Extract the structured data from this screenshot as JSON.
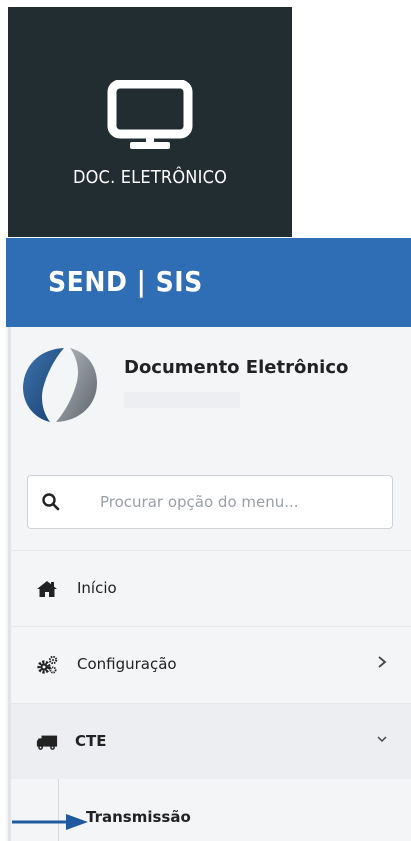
{
  "tile": {
    "label": "DOC. ELETRÔNICO",
    "icon": "monitor-icon"
  },
  "header": {
    "brand": "SEND | SIS",
    "color": "#2f6db5"
  },
  "user": {
    "name": "Documento Eletrônico",
    "avatar": "company-logo"
  },
  "search": {
    "placeholder": "Procurar opção do menu...",
    "value": ""
  },
  "menu": {
    "items": [
      {
        "label": "Início",
        "icon": "home-icon"
      },
      {
        "label": "Configuração",
        "icon": "cogs-icon",
        "expandable": true
      },
      {
        "label": "CTE",
        "icon": "truck-icon",
        "expanded": true
      }
    ],
    "sub_items": [
      {
        "label": "Transmissão"
      }
    ]
  },
  "colors": {
    "dark_tile": "#222d32",
    "accent_blue": "#2f6db5",
    "arrow": "#1f5aa0"
  }
}
